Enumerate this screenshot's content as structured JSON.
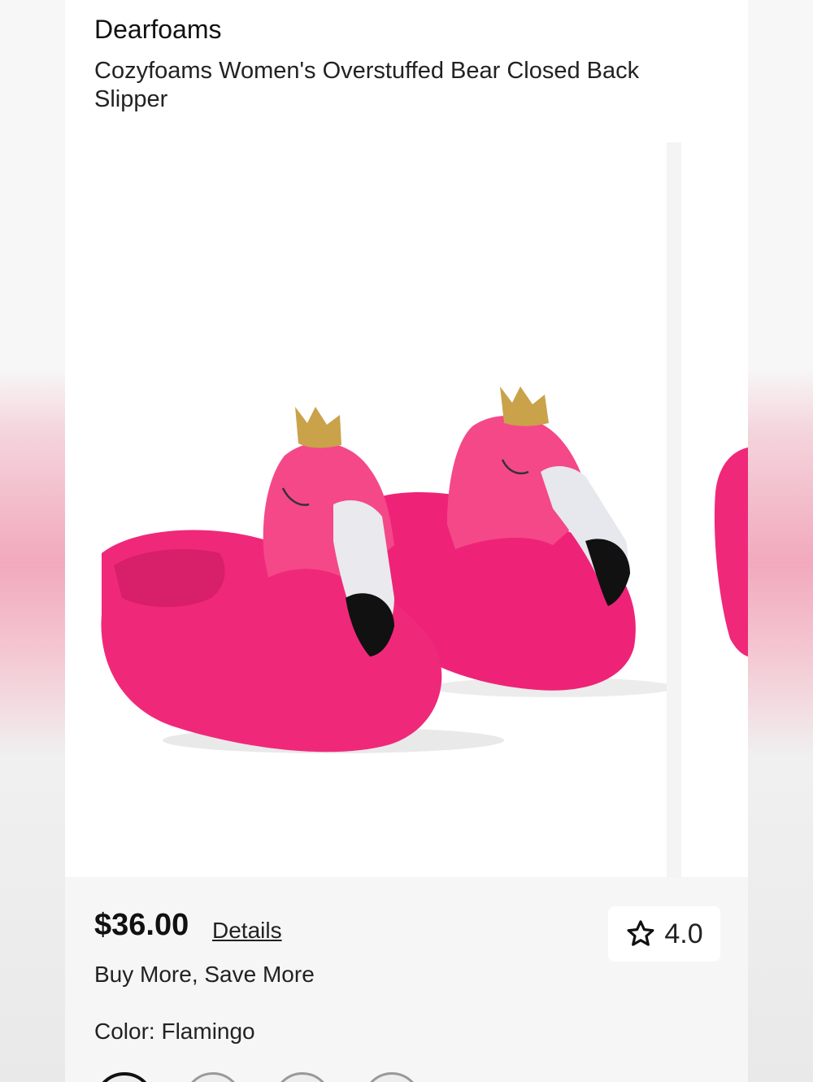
{
  "product": {
    "brand": "Dearfoams",
    "title": "Cozyfoams Women's Overstuffed Bear Closed Back Slipper"
  },
  "gallery": {
    "main_image": "flamingo-slippers-image",
    "next_image": "slipper-partial-image"
  },
  "pricing": {
    "price": "$36.00",
    "details_label": "Details",
    "promo": "Buy More, Save More"
  },
  "rating": {
    "icon": "star-outline-icon",
    "value": "4.0"
  },
  "color": {
    "label": "Color: Flamingo"
  },
  "colors": {
    "background": "#ffffff",
    "info_panel": "#f6f6f6",
    "slipper_pink": "#f0287a",
    "crown_gold": "#c9a24a"
  }
}
